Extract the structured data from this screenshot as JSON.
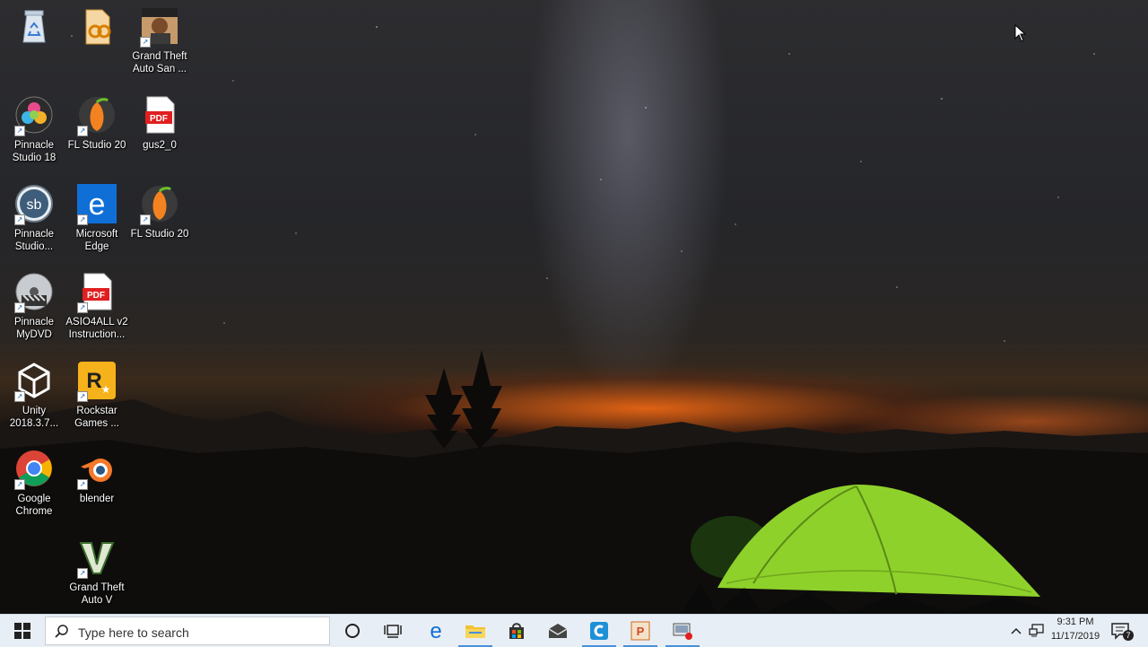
{
  "desktop": {
    "icons": [
      {
        "label": "",
        "icon": "recycle-bin-icon"
      },
      {
        "label": "",
        "icon": "audio-file-icon"
      },
      {
        "label": "Grand Theft\nAuto San ...",
        "icon": "gta-san-andreas-icon"
      },
      {
        "label": "Pinnacle\nStudio 18",
        "icon": "pinnacle-studio-icon"
      },
      {
        "label": "FL Studio 20",
        "icon": "fl-studio-icon"
      },
      {
        "label": "gus2_0",
        "icon": "pdf-icon"
      },
      {
        "label": "Pinnacle\nStudio...",
        "icon": "pinnacle-sb-icon"
      },
      {
        "label": "Microsoft\nEdge",
        "icon": "edge-icon"
      },
      {
        "label": "FL Studio 20",
        "icon": "fl-studio-icon"
      },
      {
        "label": "Pinnacle\nMyDVD",
        "icon": "pinnacle-mydvd-icon"
      },
      {
        "label": "ASIO4ALL v2\nInstruction...",
        "icon": "pdf-icon"
      },
      {
        "label": "Unity\n2018.3.7...",
        "icon": "unity-icon"
      },
      {
        "label": "Rockstar\nGames ...",
        "icon": "rockstar-icon"
      },
      {
        "label": "Google\nChrome",
        "icon": "chrome-icon"
      },
      {
        "label": "blender",
        "icon": "blender-icon"
      },
      {
        "label": "Grand Theft\nAuto V",
        "icon": "gta-v-icon"
      }
    ],
    "pdf_badge": "PDF",
    "rockstar_badge": "R"
  },
  "taskbar": {
    "search_placeholder": "Type here to search",
    "apps": [
      "cortana-icon",
      "task-view-icon",
      "edge-icon",
      "file-explorer-icon",
      "store-icon",
      "mail-icon",
      "ccleaner-icon",
      "powerpoint-icon",
      "media-app-icon"
    ],
    "clock": {
      "time": "9:31 PM",
      "date": "11/17/2019"
    },
    "notifications_count": "7"
  },
  "colors": {
    "taskbar_bg": "#e8eef5",
    "active_indicator": "#4a90d9",
    "tent": "#8fd12b"
  }
}
